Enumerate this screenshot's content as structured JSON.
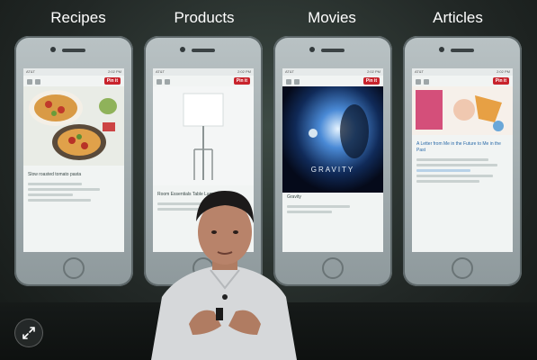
{
  "categories": [
    {
      "label": "Recipes"
    },
    {
      "label": "Products"
    },
    {
      "label": "Movies"
    },
    {
      "label": "Articles"
    }
  ],
  "screens": {
    "status_carrier": "AT&T",
    "status_time": "2:02 PM",
    "pin_label": "Pin it",
    "recipe_title": "Slow roasted tomato pasta",
    "product_title": "Room Essentials Table Lamp",
    "movie_poster_title": "GRAVITY",
    "movie_title": "Gravity",
    "article_title": "A Letter from Me in the Future to Me in the Past"
  },
  "colors": {
    "pin_red": "#c8232c",
    "shirt": "#d9dadb",
    "skin": "#b08066"
  },
  "icons": {
    "expand": "expand-arrows-icon"
  }
}
